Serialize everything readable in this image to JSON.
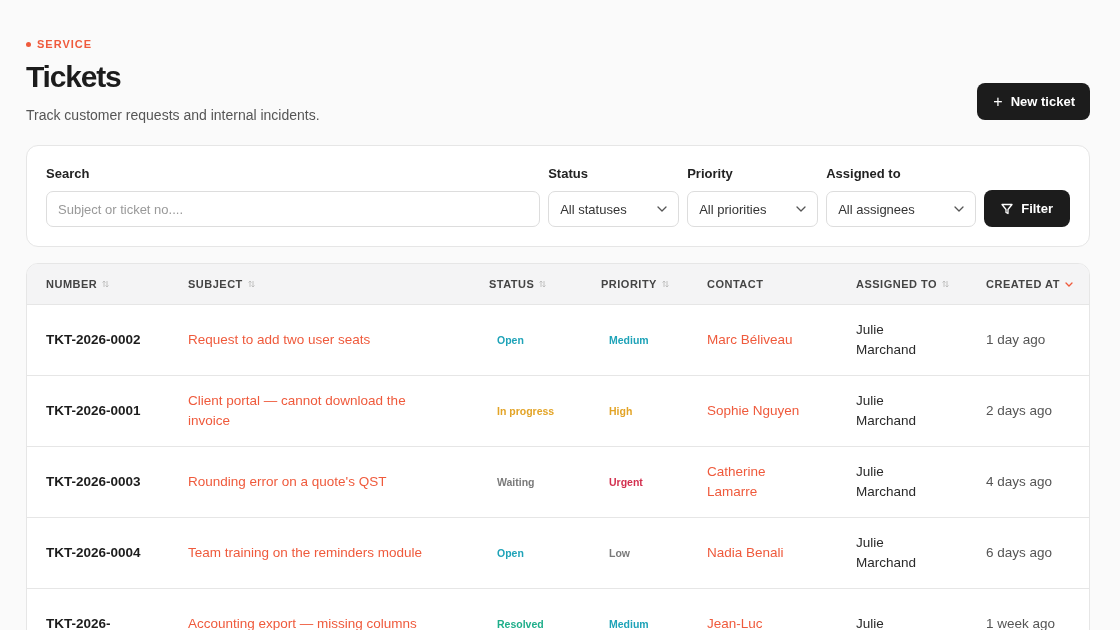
{
  "header": {
    "eyebrow": "SERVICE",
    "title": "Tickets",
    "subtitle": "Track customer requests and internal incidents.",
    "new_button": {
      "icon": "+",
      "label": "New ticket"
    }
  },
  "filters": {
    "search": {
      "label": "Search",
      "placeholder": "Subject or ticket no...."
    },
    "selects": [
      {
        "label": "Status",
        "value": "All statuses"
      },
      {
        "label": "Priority",
        "value": "All priorities"
      },
      {
        "label": "Assigned to",
        "value": "All assignees"
      }
    ],
    "button": "Filter"
  },
  "table": {
    "columns": [
      {
        "label": "NUMBER",
        "sortable": true,
        "sorted": false
      },
      {
        "label": "SUBJECT",
        "sortable": true,
        "sorted": false
      },
      {
        "label": "STATUS",
        "sortable": true,
        "sorted": false
      },
      {
        "label": "PRIORITY",
        "sortable": true,
        "sorted": false
      },
      {
        "label": "CONTACT",
        "sortable": false
      },
      {
        "label": "ASSIGNED TO",
        "sortable": true,
        "sorted": false
      },
      {
        "label": "CREATED AT",
        "sortable": true,
        "sorted": true
      }
    ],
    "rows": [
      {
        "number": "TKT-2026-0002",
        "subject": "Request to add two user seats",
        "status": {
          "label": "Open",
          "color": "#1fa3b8"
        },
        "priority": {
          "label": "Medium",
          "color": "#1fa3b8"
        },
        "contact": "Marc Béliveau",
        "assigned_to": "Julie Marchand",
        "created_at": "1 day ago"
      },
      {
        "number": "TKT-2026-0001",
        "subject": "Client portal — cannot download the invoice",
        "status": {
          "label": "In progress",
          "color": "#e3a427"
        },
        "priority": {
          "label": "High",
          "color": "#e3a427"
        },
        "contact": "Sophie Nguyen",
        "assigned_to": "Julie Marchand",
        "created_at": "2 days ago"
      },
      {
        "number": "TKT-2026-0003",
        "subject": "Rounding error on a quote's QST",
        "status": {
          "label": "Waiting",
          "color": "#7a7a7a"
        },
        "priority": {
          "label": "Urgent",
          "color": "#d3304f"
        },
        "contact": "Catherine Lamarre",
        "assigned_to": "Julie Marchand",
        "created_at": "4 days ago"
      },
      {
        "number": "TKT-2026-0004",
        "subject": "Team training on the reminders module",
        "status": {
          "label": "Open",
          "color": "#1fa3b8"
        },
        "priority": {
          "label": "Low",
          "color": "#7a7a7a"
        },
        "contact": "Nadia Benali",
        "assigned_to": "Julie Marchand",
        "created_at": "6 days ago"
      },
      {
        "number": "TKT-2026-",
        "subject": "Accounting export — missing columns",
        "status": {
          "label": "Resolved",
          "color": "#1fae8a"
        },
        "priority": {
          "label": "Medium",
          "color": "#1fa3b8"
        },
        "contact": "Jean-Luc",
        "assigned_to": "Julie",
        "created_at": "1 week ago"
      }
    ]
  }
}
